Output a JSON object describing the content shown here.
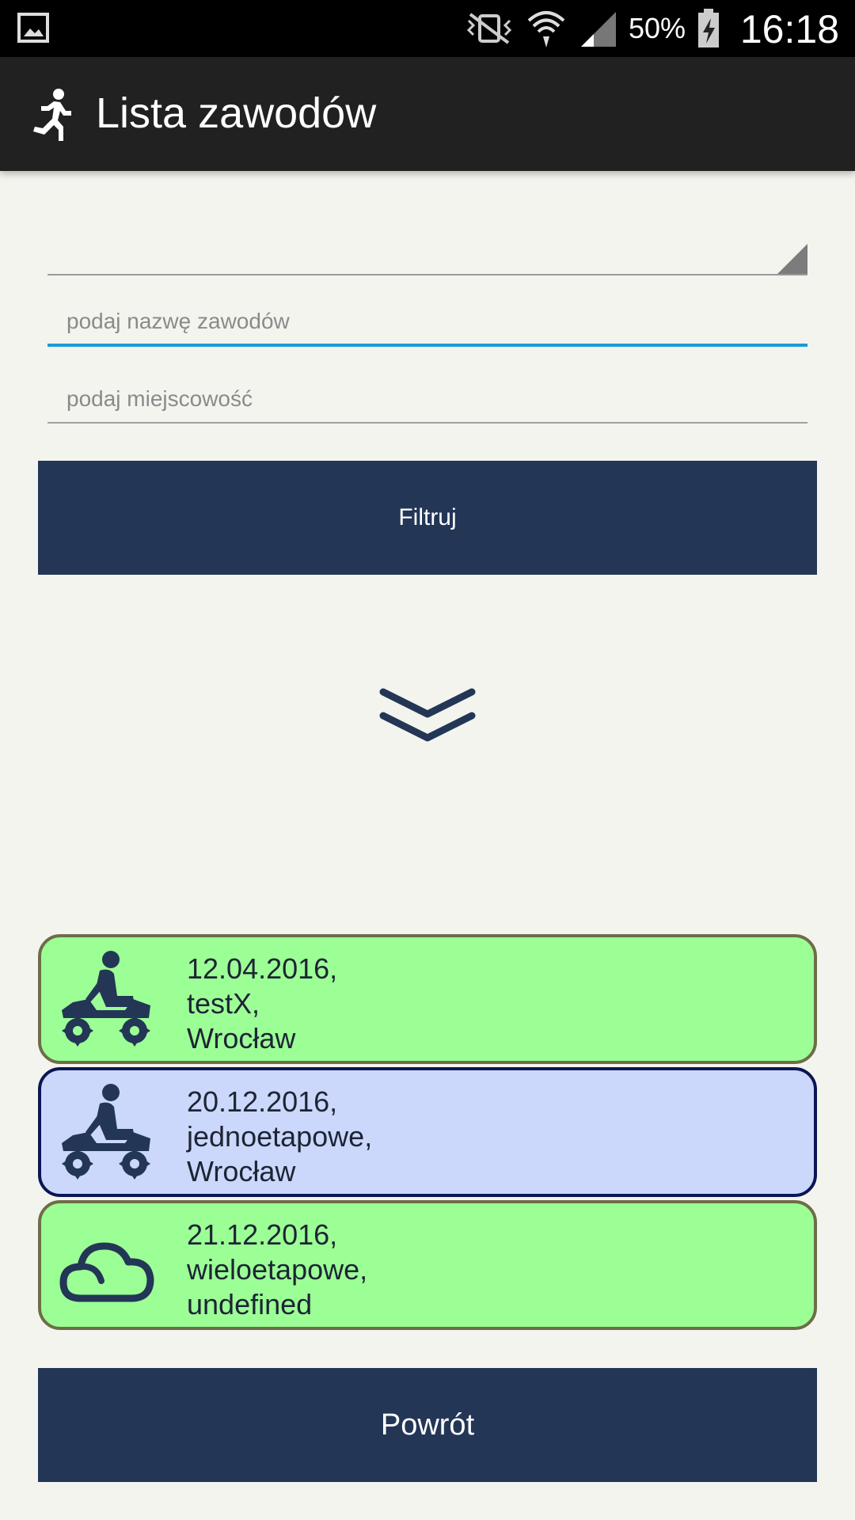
{
  "status_bar": {
    "battery_percent": "50%",
    "time": "16:18"
  },
  "app_bar": {
    "title": "Lista zawodów",
    "icon": "runner-icon"
  },
  "form": {
    "spinner_value": "",
    "name_placeholder": "podaj nazwę zawodów",
    "name_value": "",
    "city_placeholder": "podaj miejscowość",
    "city_value": "",
    "filter_label": "Filtruj"
  },
  "expand_icon": "double-chevron-down-icon",
  "competitions": [
    {
      "date": "12.04.2016,",
      "name": "testX,",
      "city": "Wrocław",
      "icon": "atv-rider-icon",
      "selected": false
    },
    {
      "date": "20.12.2016,",
      "name": "jednoetapowe,",
      "city": "Wrocław",
      "icon": "atv-rider-icon",
      "selected": true
    },
    {
      "date": "21.12.2016,",
      "name": "wieloetapowe,",
      "city": "undefined",
      "icon": "cloud-icon",
      "selected": false
    }
  ],
  "back_label": "Powrót",
  "colors": {
    "primary": "#233656",
    "item_green": "#9cff96",
    "item_selected": "#cbd8fb",
    "accent": "#1a9bd6"
  }
}
